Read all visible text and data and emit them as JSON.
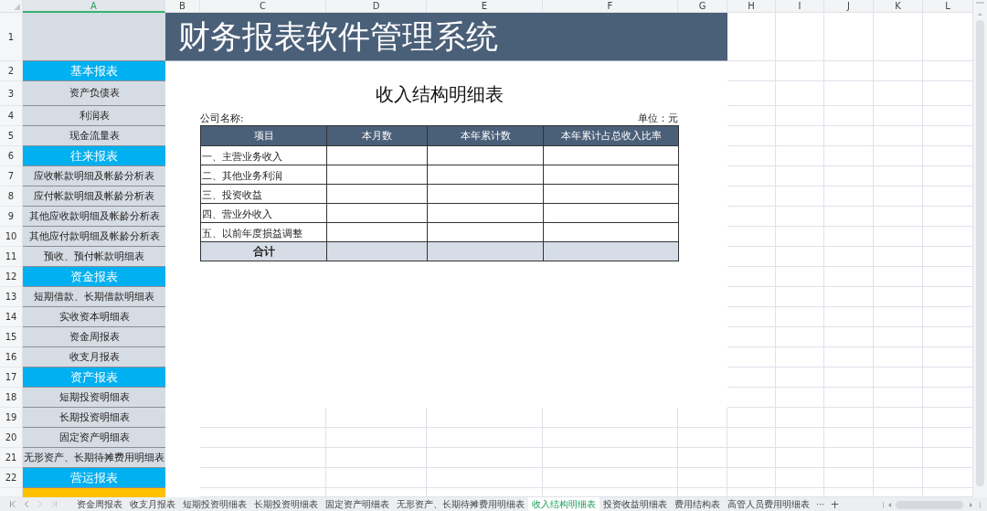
{
  "column_headers": [
    {
      "label": "A",
      "selected": true
    },
    {
      "label": "B",
      "selected": false
    },
    {
      "label": "C",
      "selected": false
    },
    {
      "label": "D",
      "selected": false
    },
    {
      "label": "E",
      "selected": false
    },
    {
      "label": "F",
      "selected": false
    },
    {
      "label": "G",
      "selected": false
    },
    {
      "label": "H",
      "selected": false
    },
    {
      "label": "I",
      "selected": false
    },
    {
      "label": "J",
      "selected": false
    },
    {
      "label": "K",
      "selected": false
    },
    {
      "label": "L",
      "selected": false
    }
  ],
  "row_numbers": [
    "1",
    "2",
    "3",
    "4",
    "5",
    "6",
    "7",
    "8",
    "9",
    "10",
    "11",
    "12",
    "13",
    "14",
    "15",
    "16",
    "17",
    "18",
    "19",
    "20",
    "21",
    "22"
  ],
  "title_banner": "财务报表软件管理系统",
  "navigation": [
    {
      "kind": "category",
      "label": "基本报表"
    },
    {
      "kind": "item",
      "label": "资产负债表"
    },
    {
      "kind": "item",
      "label": "利润表"
    },
    {
      "kind": "item",
      "label": "现金流量表"
    },
    {
      "kind": "category",
      "label": "往来报表"
    },
    {
      "kind": "item",
      "label": "应收帐款明细及帐龄分析表"
    },
    {
      "kind": "item",
      "label": "应付帐款明细及帐龄分析表"
    },
    {
      "kind": "item",
      "label": "其他应收款明细及帐龄分析表"
    },
    {
      "kind": "item",
      "label": "其他应付款明细及帐龄分析表"
    },
    {
      "kind": "item",
      "label": "预收、预付帐款明细表"
    },
    {
      "kind": "category",
      "label": "资金报表"
    },
    {
      "kind": "item",
      "label": "短期借款、长期借款明细表"
    },
    {
      "kind": "item",
      "label": "实收资本明细表"
    },
    {
      "kind": "item",
      "label": "资金周报表"
    },
    {
      "kind": "item",
      "label": "收支月报表"
    },
    {
      "kind": "category",
      "label": "资产报表"
    },
    {
      "kind": "item",
      "label": "短期投资明细表"
    },
    {
      "kind": "item",
      "label": "长期投资明细表"
    },
    {
      "kind": "item",
      "label": "固定资产明细表"
    },
    {
      "kind": "item",
      "label": "无形资产、长期待摊费用明细表"
    },
    {
      "kind": "category",
      "label": "营运报表"
    }
  ],
  "report": {
    "title": "收入结构明细表",
    "company_label": "公司名称:",
    "unit_label": "单位：元",
    "columns": [
      "项目",
      "本月数",
      "本年累计数",
      "本年累计占总收入比率"
    ],
    "rows": [
      "一、主营业务收入",
      "二、其他业务利润",
      "三、投资收益",
      "四、营业外收入",
      "五、以前年度损益调整"
    ],
    "total_label": "合计"
  },
  "sheet_tabs": [
    {
      "label": "资金周报表",
      "selected": false
    },
    {
      "label": "收支月报表",
      "selected": false
    },
    {
      "label": "短期投资明细表",
      "selected": false
    },
    {
      "label": "长期投资明细表",
      "selected": false
    },
    {
      "label": "固定资产明细表",
      "selected": false
    },
    {
      "label": "无形资产、长期待摊费用明细表",
      "selected": false
    },
    {
      "label": "收入结构明细表",
      "selected": true
    },
    {
      "label": "投资收益明细表",
      "selected": false
    },
    {
      "label": "费用结构表",
      "selected": false
    },
    {
      "label": "高管人员费用明细表",
      "selected": false
    }
  ],
  "more_tabs": "···",
  "add_tab": "+"
}
